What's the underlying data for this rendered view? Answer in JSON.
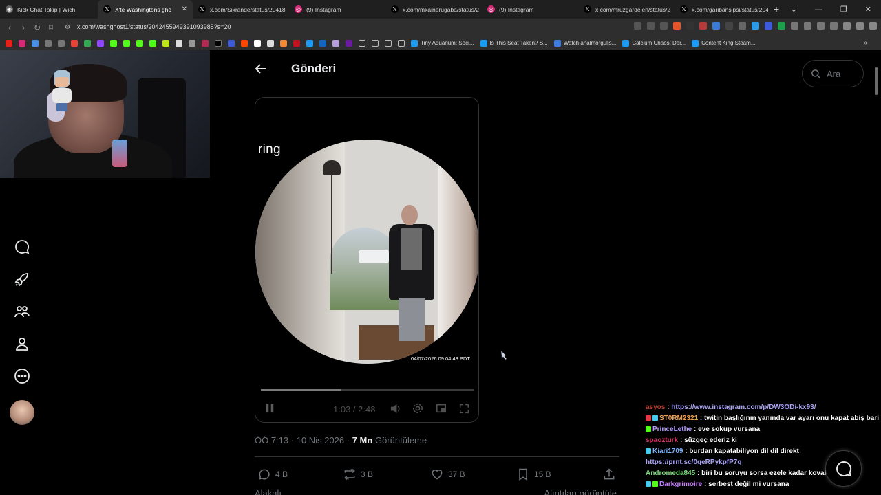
{
  "browser": {
    "tabs": [
      {
        "title": "Kick Chat Takip | Wich",
        "favicon_color": "#888888",
        "active": false
      },
      {
        "title": "X'te Washingtons gho",
        "favicon_color": "#000000",
        "active": true
      },
      {
        "title": "x.com/Sixrande/status/20418",
        "favicon_color": "#000000",
        "active": false
      },
      {
        "title": "(9) Instagram",
        "favicon_color": "#d62976",
        "active": false
      },
      {
        "title": "x.com/mkainerugaba/status/2",
        "favicon_color": "#000000",
        "active": false
      },
      {
        "title": "(9) Instagram",
        "favicon_color": "#d62976",
        "active": false
      },
      {
        "title": "x.com/mruzgardelen/status/2",
        "favicon_color": "#000000",
        "active": false
      },
      {
        "title": "x.com/garibansipsi/status/204",
        "favicon_color": "#000000",
        "active": false
      }
    ],
    "url": "x.com/washghost1/status/2042455949391093985?s=20",
    "bookmarks": [
      {
        "label": "Tiny Aquarium: Soci...",
        "icon_color": "#1d9bf0"
      },
      {
        "label": "Is This Seat Taken? S...",
        "icon_color": "#1d9bf0"
      },
      {
        "label": "Watch analmorgulis...",
        "icon_color": "#3d7be0"
      },
      {
        "label": "Calcium Chaos: Der...",
        "icon_color": "#1d9bf0"
      },
      {
        "label": "Content King Steam...",
        "icon_color": "#1d9bf0"
      }
    ]
  },
  "header": {
    "title": "Gönderi",
    "search_placeholder": "Ara"
  },
  "video": {
    "watermark": "ring",
    "timestamp": "04/07/2026 09:04:43 PDT",
    "time": "1:03 / 2:48",
    "progress": 0.375
  },
  "post": {
    "time": "ÖÖ 7:13",
    "date": "10 Nis 2026",
    "views_count": "7 Mn",
    "views_label": "Görüntüleme",
    "separator": "·",
    "replies": "4 B",
    "reposts": "3 B",
    "likes": "37 B",
    "bookmarks": "15 B",
    "sub_left": "Alakalı",
    "sub_right": "Alıntıları görüntüle"
  },
  "chat": [
    {
      "user": "asyos",
      "color": "#c0392b",
      "text": "https://www.instagram.com/p/DW3ODi-kx93/",
      "link": true,
      "badges": []
    },
    {
      "user": "ST0RM2321",
      "color": "#f0a14b",
      "text": "twitin başlığının yanında var ayarı onu kapat abiş bari",
      "link": false,
      "badges": [
        "#e63946",
        "#4cc9f0"
      ]
    },
    {
      "user": "PrinceLethe",
      "color": "#b69cff",
      "text": "eve sokup vursana",
      "link": false,
      "badges": [
        "#53fc18"
      ]
    },
    {
      "user": "spaozturk",
      "color": "#d6336c",
      "text": "süzgeç ederiz ki",
      "link": false,
      "badges": []
    },
    {
      "user": "Kiari1709",
      "color": "#7db0ff",
      "text": "burdan kapatabiliyon dil dil direkt",
      "link": false,
      "badges": [
        "#4cc9f0"
      ]
    },
    {
      "user": "",
      "color": "#a9a4f7",
      "text": "https://prnt.sc/0qeRPykpfP7q",
      "link": true,
      "badges": []
    },
    {
      "user": "Andromeda845",
      "color": "#7be07b",
      "text": "biri bu soruyu sorsa ezele kadar kovalarım",
      "link": false,
      "badges": []
    },
    {
      "user": "Darkgrimoire",
      "color": "#c77dff",
      "text": "serbest değil mi vursana",
      "link": false,
      "badges": [
        "#4cc9f0",
        "#53fc18"
      ]
    }
  ],
  "icons": {
    "nav": [
      "chat-bubble-icon",
      "rocket-icon",
      "communities-icon",
      "profile-icon",
      "more-icon"
    ],
    "accent": "#1d9bf0"
  }
}
